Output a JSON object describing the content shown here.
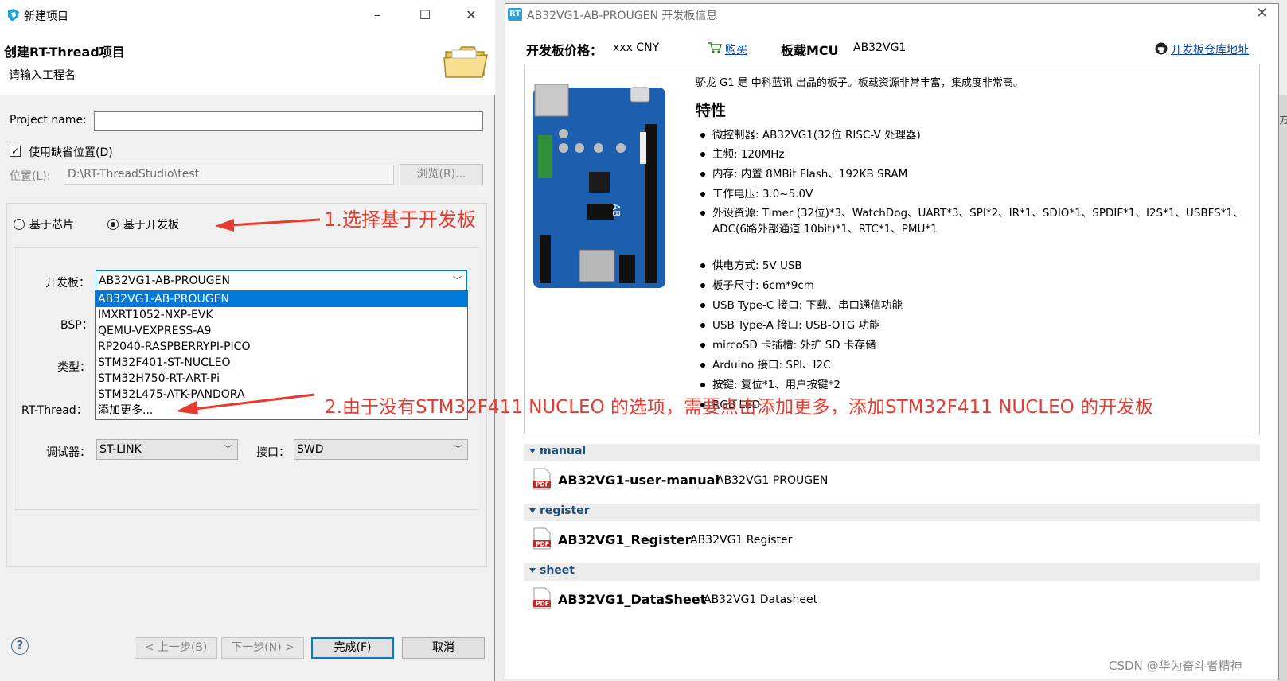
{
  "wizard": {
    "window_title": "新建项目",
    "header_title": "创建RT-Thread项目",
    "header_subtitle": "请输入工程名",
    "project_name_label": "Project name:",
    "project_name_value": "",
    "use_default_location_label": "使用缺省位置(D)",
    "use_default_location_checked": true,
    "location_label": "位置(L):",
    "location_value": "D:\\RT-ThreadStudio\\test",
    "browse_button": "浏览(R)...",
    "radio_chip": "基于芯片",
    "radio_board": "基于开发板",
    "selected_mode": "基于开发板",
    "board_label": "开发板：",
    "board_value": "AB32VG1-AB-PROUGEN",
    "bsp_label": "BSP：",
    "type_label": "类型：",
    "rtthread_label": "RT-Thread：",
    "board_options": [
      "AB32VG1-AB-PROUGEN",
      "IMXRT1052-NXP-EVK",
      "QEMU-VEXPRESS-A9",
      "RP2040-RASPBERRYPI-PICO",
      "STM32F401-ST-NUCLEO",
      "STM32H750-RT-ART-Pi",
      "STM32L475-ATK-PANDORA",
      "添加更多..."
    ],
    "debugger_label": "调试器：",
    "debugger_value": "ST-LINK",
    "interface_label": "接口：",
    "interface_value": "SWD",
    "help_icon": "?",
    "back_button": "< 上一步(B)",
    "next_button": "下一步(N) >",
    "finish_button": "完成(F)",
    "cancel_button": "取消"
  },
  "board_info": {
    "window_title": "AB32VG1-AB-PROUGEN 开发板信息",
    "app_icon_text": "RT",
    "price_label": "开发板价格：",
    "price_value": "xxx CNY",
    "buy_link": "购买",
    "mcu_label": "板载MCU",
    "mcu_value": "AB32VG1",
    "repo_link": "开发板仓库地址",
    "intro": "骄龙 G1 是 中科蓝讯 出品的板子。板载资源非常丰富，集成度非常高。",
    "features_title": "特性",
    "features": [
      "微控制器: AB32VG1(32位 RISC-V 处理器)",
      "主频: 120MHz",
      "内存: 内置 8MBit Flash、192KB SRAM",
      "工作电压: 3.0~5.0V",
      "外设资源: Timer (32位)*3、WatchDog、UART*3、SPI*2、IR*1、SDIO*1、SPDIF*1、I2S*1、USBFS*1、ADC(6路外部通道 10bit)*1、RTC*1、PMU*1",
      "供电方式: 5V USB",
      "板子尺寸: 6cm*9cm",
      "USB Type-C 接口: 下载、串口通信功能",
      "USB Type-A 接口: USB-OTG 功能",
      "mircoSD 卡插槽: 外扩 SD 卡存储",
      "Arduino 接口: SPI、I2C",
      "按键: 复位*1、用户按键*2",
      "RGB LED"
    ],
    "sections": [
      {
        "name": "manual",
        "doc_title": "AB32VG1-user-manual",
        "doc_desc": "AB32VG1 PROUGEN"
      },
      {
        "name": "register",
        "doc_title": "AB32VG1_Register",
        "doc_desc": "AB32VG1 Register"
      },
      {
        "name": "sheet",
        "doc_title": "AB32VG1_DataSheet",
        "doc_desc": "AB32VG1 Datasheet"
      }
    ]
  },
  "annotations": {
    "step1": "1.选择基于开发板",
    "step2": "2.由于没有STM32F411 NUCLEO 的选项，需要点击添加更多，添加STM32F411 NUCLEO 的开发板"
  },
  "background_right_text": "方",
  "watermark": "CSDN @华为奋斗者精神",
  "colors": {
    "accent": "#0078d7",
    "annotation": "#e83a2f",
    "link": "#0645ad",
    "section_header": "#1f4e79"
  }
}
